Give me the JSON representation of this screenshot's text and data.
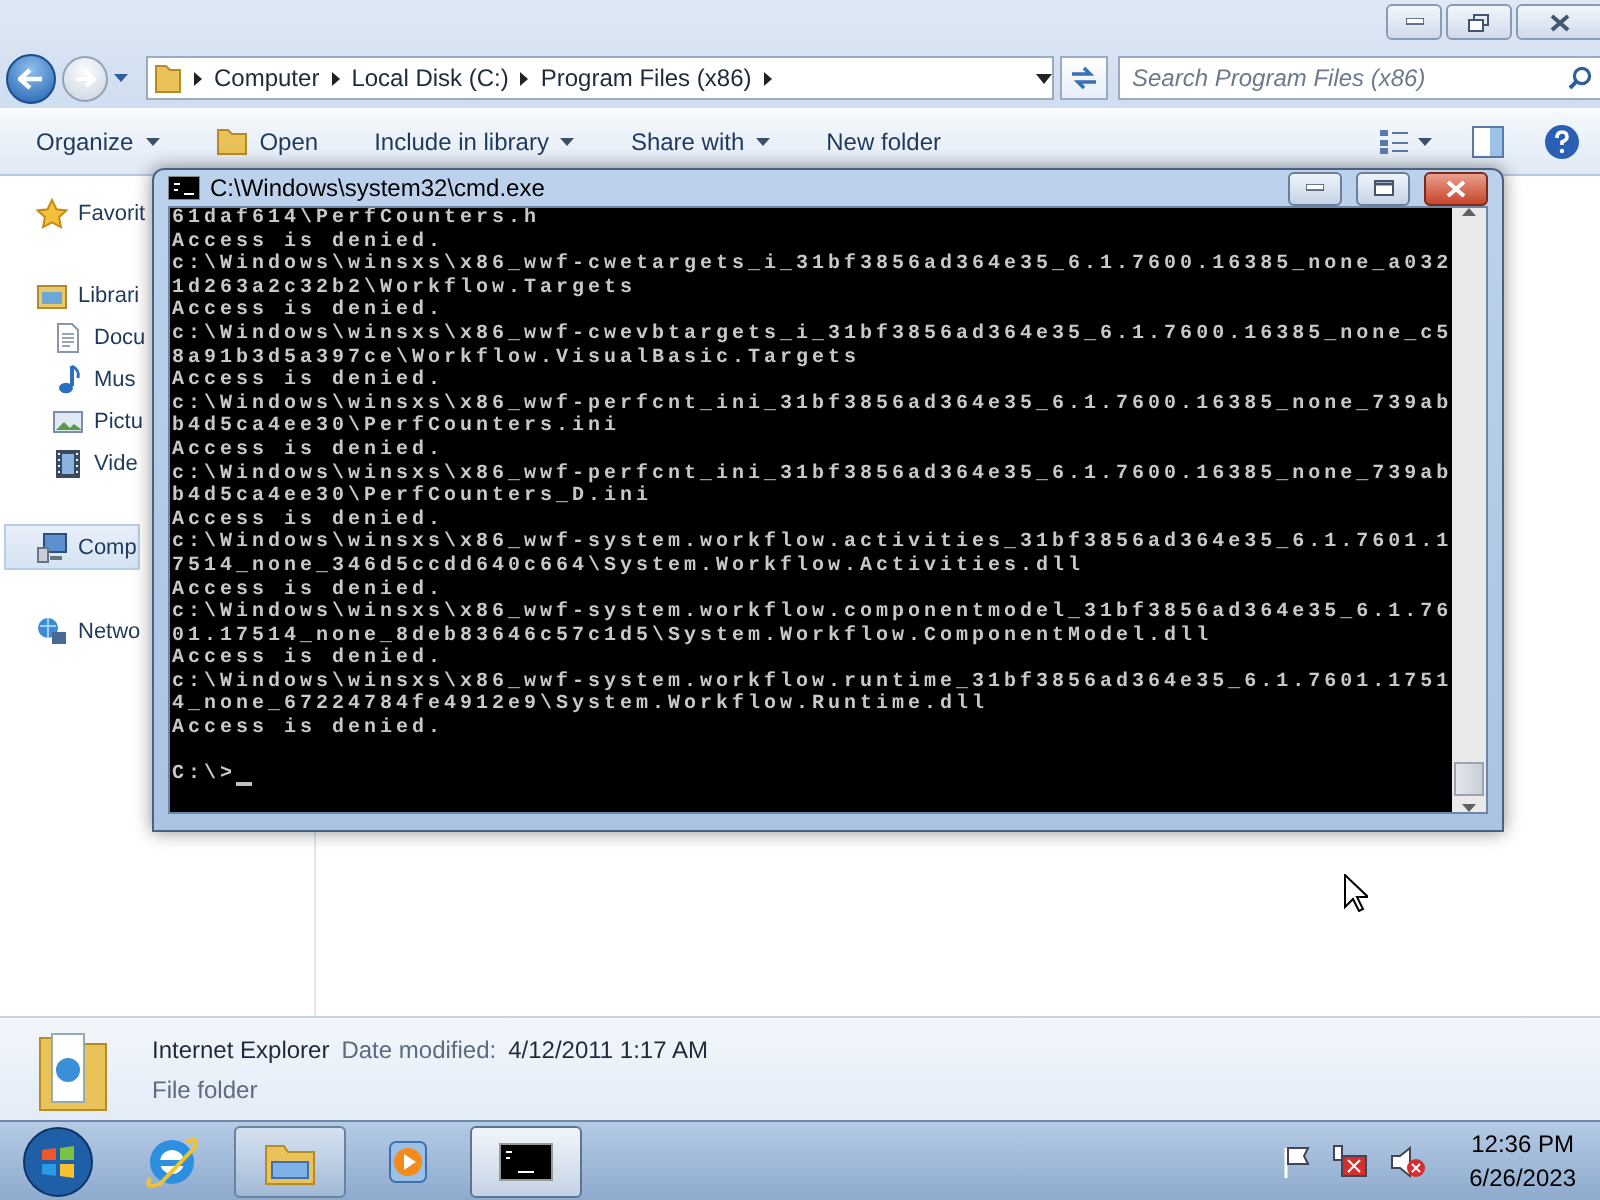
{
  "explorer": {
    "nav": [
      {
        "kind": "back",
        "disabled": false
      },
      {
        "kind": "forward",
        "disabled": true
      }
    ],
    "breadcrumb": [
      "Computer",
      "Local Disk (C:)",
      "Program Files (x86)"
    ],
    "search": {
      "placeholder": "Search Program Files (x86)"
    },
    "toolbar": [
      {
        "label": "Organize",
        "kind": "menu"
      },
      {
        "label": "Open",
        "kind": "open"
      },
      {
        "label": "Include in library",
        "kind": "menu"
      },
      {
        "label": "Share with",
        "kind": "menu"
      },
      {
        "label": "New folder",
        "kind": "plain"
      }
    ],
    "sidebar": [
      {
        "label": "Favorit",
        "kind": "star",
        "selected": false
      },
      {
        "label": "Librari",
        "kind": "library",
        "selected": false,
        "children": [
          {
            "label": "Docu",
            "kind": "document",
            "selected": false
          },
          {
            "label": "Mus",
            "kind": "music",
            "selected": false
          },
          {
            "label": "Pictu",
            "kind": "pictures",
            "selected": false
          },
          {
            "label": "Vide",
            "kind": "videos",
            "selected": false
          }
        ]
      },
      {
        "label": "Comp",
        "kind": "computer",
        "selected": true
      },
      {
        "label": "Netwo",
        "kind": "network",
        "selected": false
      }
    ],
    "details": {
      "name": "Internet Explorer",
      "date_label": "Date modified:",
      "date": "4/12/2011 1:17 AM",
      "type": "File folder"
    }
  },
  "cmd": {
    "title": "C:\\Windows\\system32\\cmd.exe",
    "lines": [
      "61daf614\\PerfCounters.h",
      "Access is denied.",
      "c:\\Windows\\winsxs\\x86_wwf-cwetargets_i_31bf3856ad364e35_6.1.7600.16385_none_a032",
      "1d263a2c32b2\\Workflow.Targets",
      "Access is denied.",
      "c:\\Windows\\winsxs\\x86_wwf-cwevbtargets_i_31bf3856ad364e35_6.1.7600.16385_none_c5",
      "8a91b3d5a397ce\\Workflow.VisualBasic.Targets",
      "Access is denied.",
      "c:\\Windows\\winsxs\\x86_wwf-perfcnt_ini_31bf3856ad364e35_6.1.7600.16385_none_739ab",
      "b4d5ca4ee30\\PerfCounters.ini",
      "Access is denied.",
      "c:\\Windows\\winsxs\\x86_wwf-perfcnt_ini_31bf3856ad364e35_6.1.7600.16385_none_739ab",
      "b4d5ca4ee30\\PerfCounters_D.ini",
      "Access is denied.",
      "c:\\Windows\\winsxs\\x86_wwf-system.workflow.activities_31bf3856ad364e35_6.1.7601.1",
      "7514_none_346d5ccdd640c664\\System.Workflow.Activities.dll",
      "Access is denied.",
      "c:\\Windows\\winsxs\\x86_wwf-system.workflow.componentmodel_31bf3856ad364e35_6.1.76",
      "01.17514_none_8deb83646c57c1d5\\System.Workflow.ComponentModel.dll",
      "Access is denied.",
      "c:\\Windows\\winsxs\\x86_wwf-system.workflow.runtime_31bf3856ad364e35_6.1.7601.1751",
      "4_none_67224784fe4912e9\\System.Workflow.Runtime.dll",
      "Access is denied."
    ],
    "prompt": "C:\\>"
  },
  "taskbar": {
    "apps": [
      {
        "kind": "ie",
        "running": false,
        "selected": false
      },
      {
        "kind": "explorer",
        "running": true,
        "selected": false
      },
      {
        "kind": "media",
        "running": false,
        "selected": false
      },
      {
        "kind": "cmd",
        "running": true,
        "selected": true
      }
    ],
    "clock": {
      "time": "12:36 PM",
      "date": "6/26/2023"
    }
  }
}
